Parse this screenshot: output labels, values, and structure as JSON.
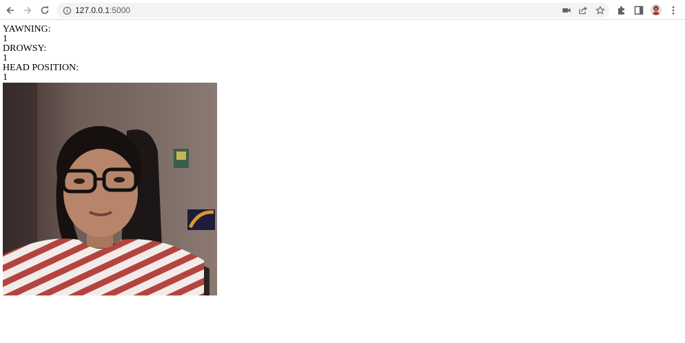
{
  "browser": {
    "url_host": "127.0.0.1",
    "url_port": ":5000",
    "icons": {
      "back": "arrow-left-icon",
      "forward": "arrow-right-icon",
      "reload": "reload-icon",
      "site_info": "info-icon",
      "camera": "camera-icon",
      "share": "share-icon",
      "bookmark": "star-icon",
      "extensions": "puzzle-icon",
      "side_panel": "side-panel-icon",
      "profile": "avatar",
      "menu": "kebab-menu-icon"
    }
  },
  "page": {
    "yawning_label": "YAWNING:",
    "yawning_value": "1",
    "drowsy_label": "DROWSY:",
    "drowsy_value": "1",
    "head_label": "HEAD POSITION:",
    "head_value": "1"
  }
}
